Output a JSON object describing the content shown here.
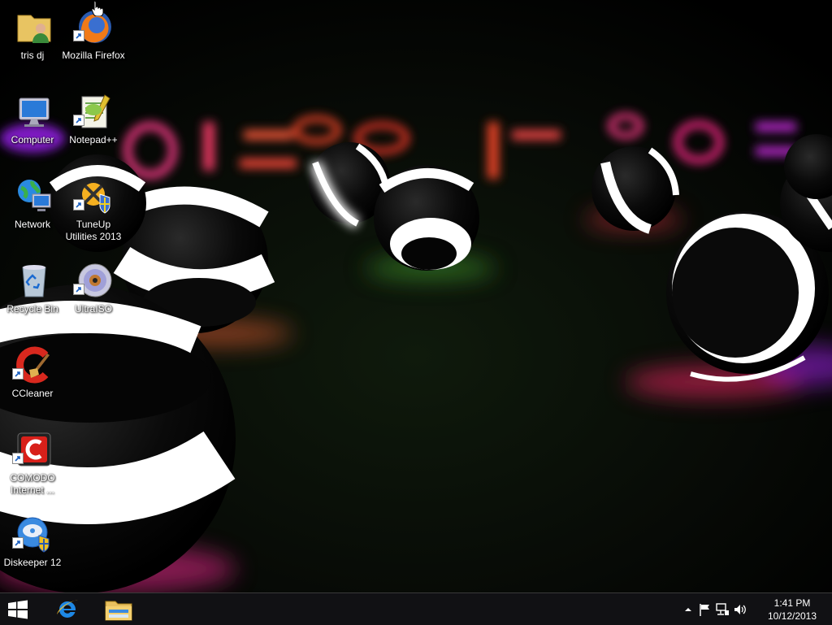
{
  "desktop": {
    "icons": [
      {
        "label": "tris dj",
        "icon": "user-folder-icon"
      },
      {
        "label": "Mozilla Firefox",
        "icon": "firefox-icon"
      },
      {
        "label": "Computer",
        "icon": "computer-icon"
      },
      {
        "label": "Notepad++",
        "icon": "notepadplusplus-icon"
      },
      {
        "label": "Network",
        "icon": "network-icon"
      },
      {
        "label": "TuneUp Utilities 2013",
        "icon": "tuneup-icon"
      },
      {
        "label": "Recycle Bin",
        "icon": "recycle-bin-icon"
      },
      {
        "label": "UltraISO",
        "icon": "ultraiso-icon"
      },
      {
        "label": "CCleaner",
        "icon": "ccleaner-icon"
      },
      {
        "label": "COMODO Internet ...",
        "icon": "comodo-icon"
      },
      {
        "label": "Diskeeper 12",
        "icon": "diskeeper-icon"
      }
    ]
  },
  "taskbar": {
    "pinned": [
      "windows-start-icon",
      "internet-explorer-icon",
      "file-explorer-icon"
    ],
    "tray_icons": [
      "chevron-up-icon",
      "action-center-flag-icon",
      "network-status-icon",
      "volume-icon"
    ],
    "clock": {
      "time": "1:41 PM",
      "date": "10/12/2013"
    }
  },
  "colors": {
    "taskbar": "#121216",
    "accent_blue": "#1e88e5",
    "wallpaper_glow_pink": "#ff2a6a",
    "wallpaper_glow_purple": "#b020ff"
  }
}
